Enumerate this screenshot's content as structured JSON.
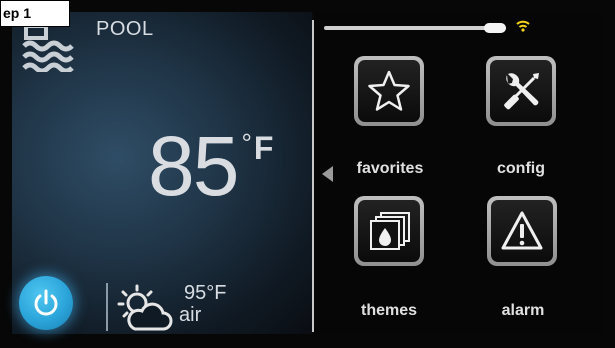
{
  "step_label": "ep 1",
  "status": {
    "mode": "POOL",
    "water_temp_value": "85",
    "water_temp_degree": "°",
    "water_temp_unit": "F",
    "air_temp": "95°F",
    "air_label": "air"
  },
  "menu": {
    "items": [
      {
        "label": "favorites",
        "icon": "star-icon"
      },
      {
        "label": "config",
        "icon": "tools-icon"
      },
      {
        "label": "themes",
        "icon": "themes-icon"
      },
      {
        "label": "alarm",
        "icon": "alarm-icon"
      }
    ]
  },
  "colors": {
    "accent_power": "#2ba4da",
    "wifi": "#f2d21a",
    "text": "#d9dde1"
  }
}
